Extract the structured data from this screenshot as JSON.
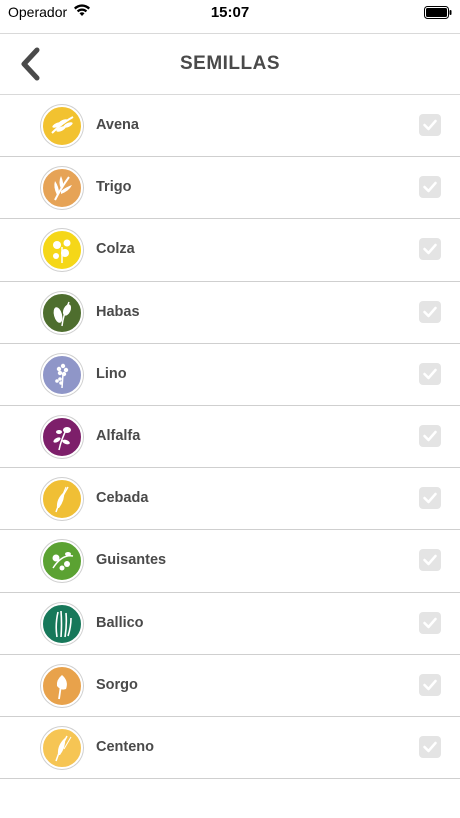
{
  "status": {
    "carrier": "Operador",
    "time": "15:07"
  },
  "header": {
    "title": "SEMILLAS"
  },
  "seeds": [
    {
      "name": "Avena",
      "color": "#f2c230",
      "icon": "oat-icon"
    },
    {
      "name": "Trigo",
      "color": "#e6a356",
      "icon": "wheat-icon"
    },
    {
      "name": "Colza",
      "color": "#f5d718",
      "icon": "rapeseed-icon"
    },
    {
      "name": "Habas",
      "color": "#4e6e2e",
      "icon": "bean-icon"
    },
    {
      "name": "Lino",
      "color": "#8f96c8",
      "icon": "flax-icon"
    },
    {
      "name": "Alfalfa",
      "color": "#7d1f6a",
      "icon": "alfalfa-icon"
    },
    {
      "name": "Cebada",
      "color": "#f0bf35",
      "icon": "barley-icon"
    },
    {
      "name": "Guisantes",
      "color": "#5ba232",
      "icon": "pea-icon"
    },
    {
      "name": "Ballico",
      "color": "#17785a",
      "icon": "ryegrass-icon"
    },
    {
      "name": "Sorgo",
      "color": "#e8a24b",
      "icon": "sorghum-icon"
    },
    {
      "name": "Centeno",
      "color": "#f6c554",
      "icon": "rye-icon"
    }
  ],
  "colors": {
    "title": "#4a4a4a",
    "checkbox": "#e4e4e4",
    "checkmark": "#ffffff",
    "divider": "#cfcfcf"
  }
}
